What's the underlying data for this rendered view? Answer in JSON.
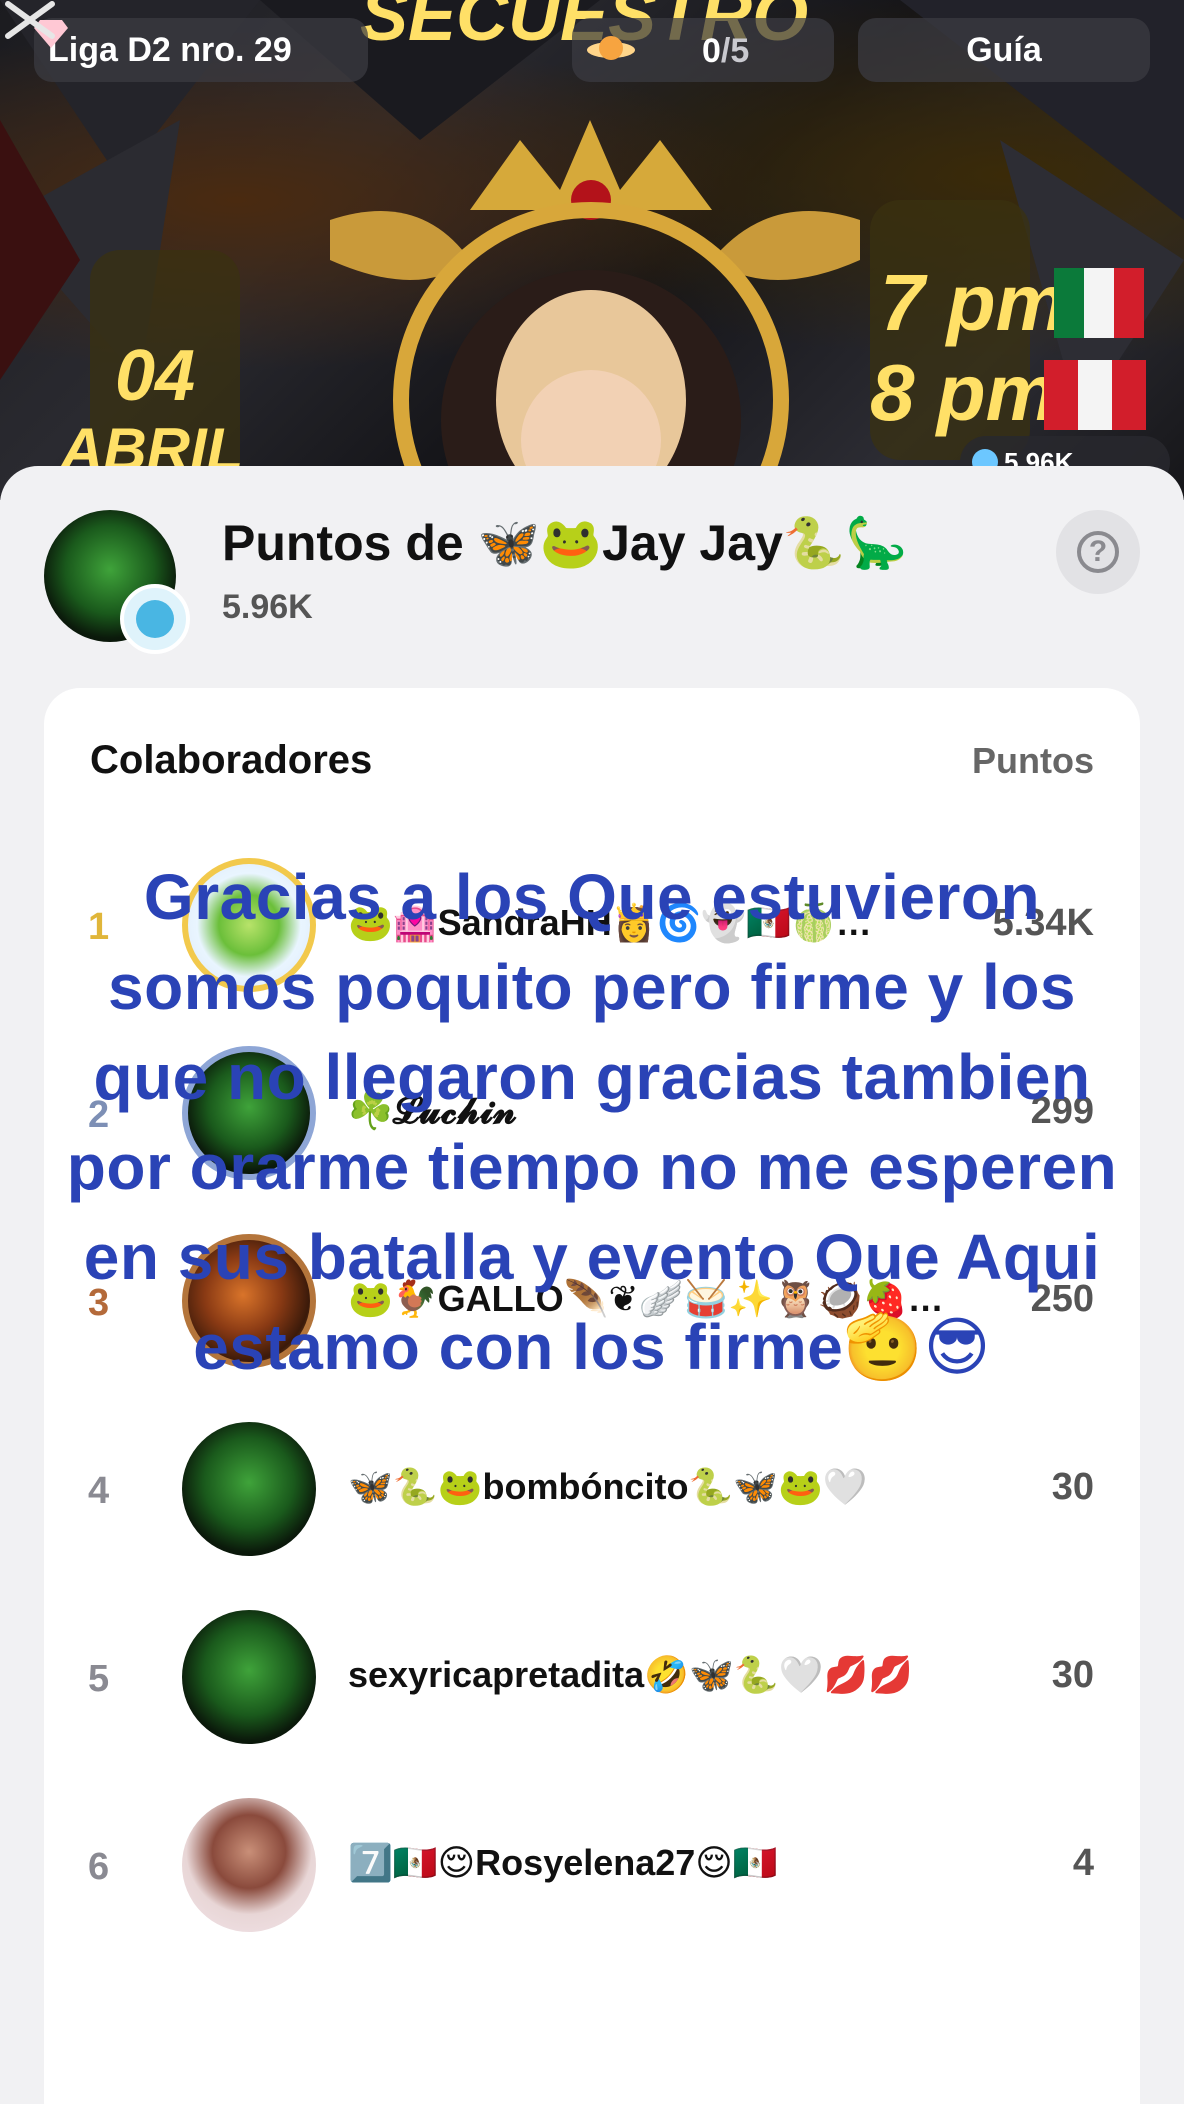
{
  "top_bar": {
    "league_label": "Liga D2 nro. 29",
    "progress_current": "0",
    "progress_total": "/5",
    "guide_label": "Guía"
  },
  "banner": {
    "points_badge": "5.96K"
  },
  "host": {
    "title": "Puntos de 🦋🐸Jay Jay🐍🦕",
    "points": "5.96K"
  },
  "contributors": {
    "header_left": "Colaboradores",
    "header_right": "Puntos",
    "rows": [
      {
        "rank": "1",
        "name": "🐸🏩SandraHH👸🌀👻🇲🇽🍈…",
        "points": "5.34K"
      },
      {
        "rank": "2",
        "name": "☘️𝓛𝓾𝓬𝓱𝓲𝓷",
        "points": "299"
      },
      {
        "rank": "3",
        "name": "🐸🐓GALLO🪶❦🪽🥁✨🦉🥥🍓…",
        "points": "250"
      },
      {
        "rank": "4",
        "name": "🦋🐍🐸bombóncito🐍🦋🐸🤍",
        "points": "30"
      },
      {
        "rank": "5",
        "name": "sexyricapretadita🤣🦋🐍🤍💋💋",
        "points": "30"
      },
      {
        "rank": "6",
        "name": "7️⃣🇲🇽😌Rosyelena27😌🇲🇽",
        "points": "4"
      }
    ]
  },
  "overlay_caption": "Gracias a los Que estuvieron somos poquito pero firme y los que no llegaron gracias tambien por orarme tiempo no me esperen en sus batalla y evento Que Aqui estamo con los firme🫡😎"
}
